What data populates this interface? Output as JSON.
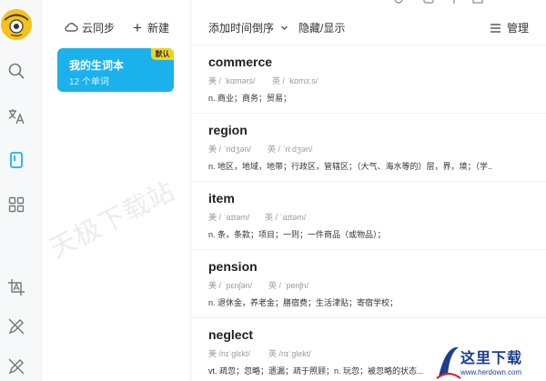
{
  "sidebar": {
    "icons": [
      "avatar-mascot",
      "search-icon",
      "translate-icon",
      "wordbook-icon",
      "apps-icon",
      "screenshot-translate-icon",
      "pen-icon",
      "settings-pen-icon"
    ],
    "active_color": "#1ab1ec"
  },
  "panel": {
    "sync_label": "云同步",
    "new_label": "新建",
    "book": {
      "title": "我的生词本",
      "count": "12 个单词",
      "badge": "默认",
      "color": "#1ab1ec",
      "badge_color": "#f5d31a"
    }
  },
  "watermark": "天极下载站",
  "toolbar": {
    "sort_label": "添加时间倒序",
    "toggle_label": "隐藏/显示",
    "manage_label": "管理"
  },
  "words": [
    {
      "word": "commerce",
      "uk": "美 / ˈkɑmərs/",
      "us": "英 / ˈkɒmɜːs/",
      "meaning": "n. 商业；商务；贸易；"
    },
    {
      "word": "region",
      "uk": "美 / ˈridʒən/",
      "us": "英 / ˈriːdʒən/",
      "meaning": "n. 地区，地域，地带；行政区，管辖区；（大气、海水等的）层，界，境；（学.."
    },
    {
      "word": "item",
      "uk": "美 / ˈaɪtəm/",
      "us": "英 / ˈaɪtəm/",
      "meaning": "n. 条，条款；项目；一则；一件商品（或物品）；"
    },
    {
      "word": "pension",
      "uk": "美 / ˈpɛnʃən/",
      "us": "英 / ˈpenʃn/",
      "meaning": "n. 退休金，养老金；膳宿费；生活津贴；寄宿学校；"
    },
    {
      "word": "neglect",
      "uk": "美 /nɪˈɡlɛkt/",
      "us": "英 /nɪˈɡlekt/",
      "meaning": "vt. 疏忽；忽略；遗漏；疏于照顾；n. 玩忽；被忽略的状态..."
    }
  ],
  "brand": {
    "title": "这里下载",
    "url": "www.herdown.com"
  }
}
